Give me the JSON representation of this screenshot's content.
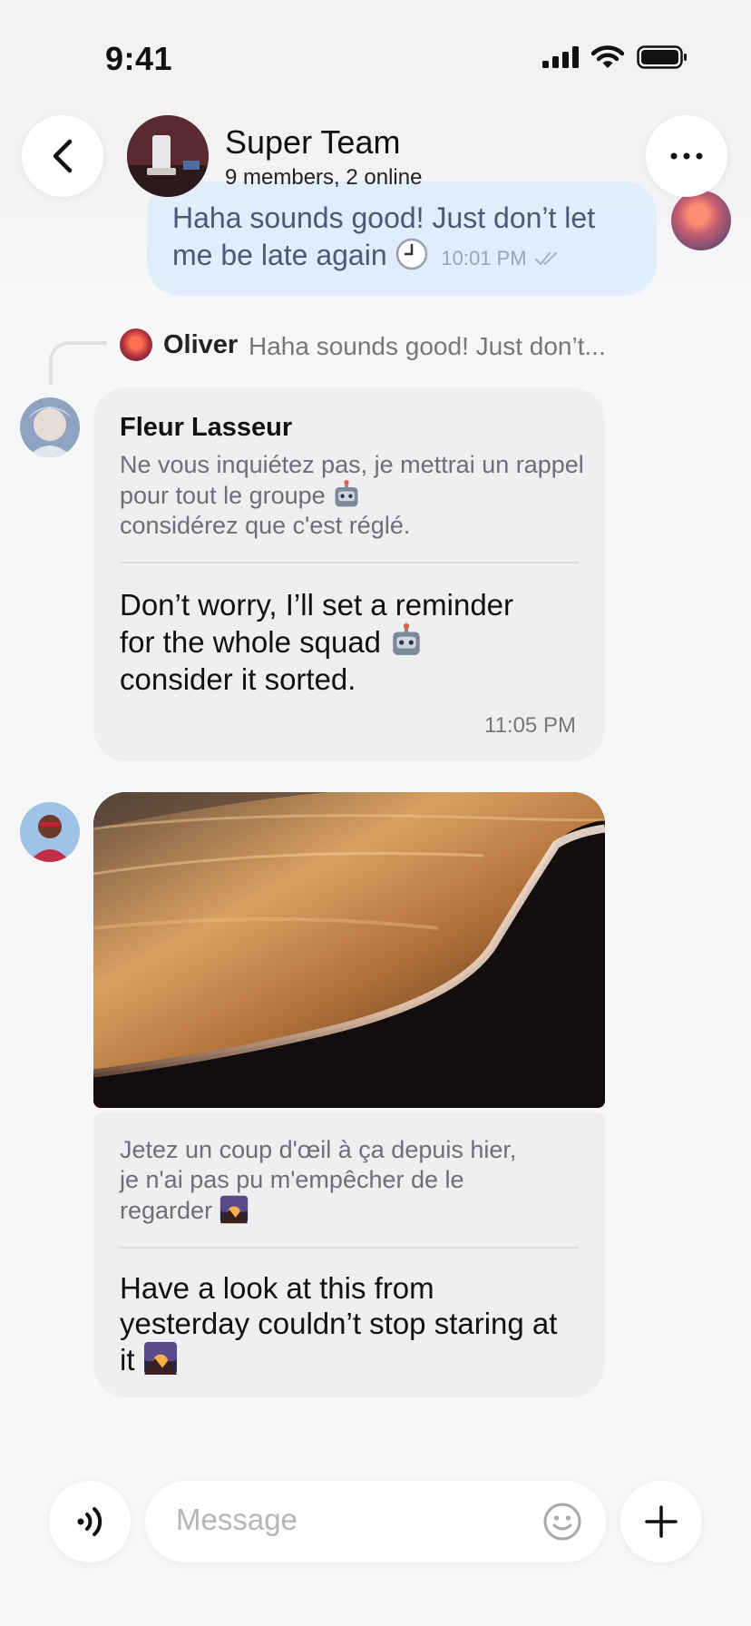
{
  "status_bar": {
    "time": "9:41"
  },
  "header": {
    "back_icon": "chevron-left-icon",
    "title": "Super Team",
    "subtitle": "9 members, 2 online",
    "more_icon": "ellipsis-icon"
  },
  "messages": {
    "sent": {
      "text": "Haha sounds good! Just don’t let me be late again",
      "emoji": "clock-icon",
      "time": "10:01 PM",
      "status_icon": "double-check-icon"
    },
    "reply_to": {
      "name": "Oliver",
      "preview": "Haha sounds good! Just don’t..."
    },
    "fleur": {
      "name": "Fleur Lasseur",
      "translated": "Ne vous inquiétez pas, je mettrai un rappel pour tout le groupe",
      "translated_after": "considérez que c'est réglé.",
      "original_line1": "Don’t worry, I’ll set a reminder",
      "original_line2": "for the whole squad",
      "original_line3": "consider it sorted.",
      "emoji": "robot-icon",
      "time": "11:05 PM"
    },
    "photo_message": {
      "image_subject": "beach shoreline at sunset",
      "translated_l1": "Jetez un coup d'œil à ça depuis hier,",
      "translated_l2": "je n'ai pas pu m'empêcher de le",
      "translated_l3": "regarder",
      "original_l1": "Have a look at this from",
      "original_l2": "yesterday couldn’t stop staring at",
      "original_l3": "it",
      "emoji": "sunrise-icon"
    }
  },
  "composer": {
    "placeholder": "Message",
    "voice_icon": "voice-waves-icon",
    "emoji_icon": "smiley-icon",
    "add_icon": "plus-icon"
  },
  "colors": {
    "background": "#f7f7f9",
    "sent_bubble": "#deecfc",
    "received_bubble": "#efeff1",
    "muted_text": "#6e6e73"
  }
}
